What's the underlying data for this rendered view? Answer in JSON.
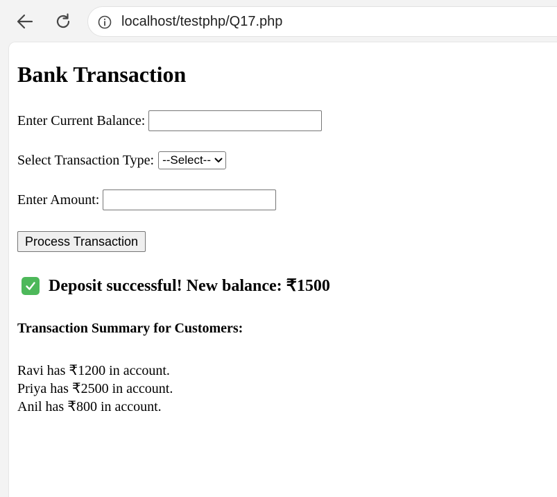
{
  "browser": {
    "url": "localhost/testphp/Q17.php"
  },
  "page": {
    "title": "Bank Transaction"
  },
  "form": {
    "balance_label": "Enter Current Balance:",
    "balance_value": "",
    "type_label": "Select Transaction Type:",
    "type_selected": "--Select--",
    "amount_label": "Enter Amount:",
    "amount_value": "",
    "submit_label": "Process Transaction"
  },
  "result": {
    "icon": "check-mark-icon",
    "icon_color": "#4db85a",
    "message": "Deposit successful! New balance: ₹1500"
  },
  "summary": {
    "heading": "Transaction Summary for Customers:",
    "customers": [
      "Ravi has ₹1200 in account.",
      "Priya has ₹2500 in account.",
      "Anil has ₹800 in account."
    ]
  }
}
